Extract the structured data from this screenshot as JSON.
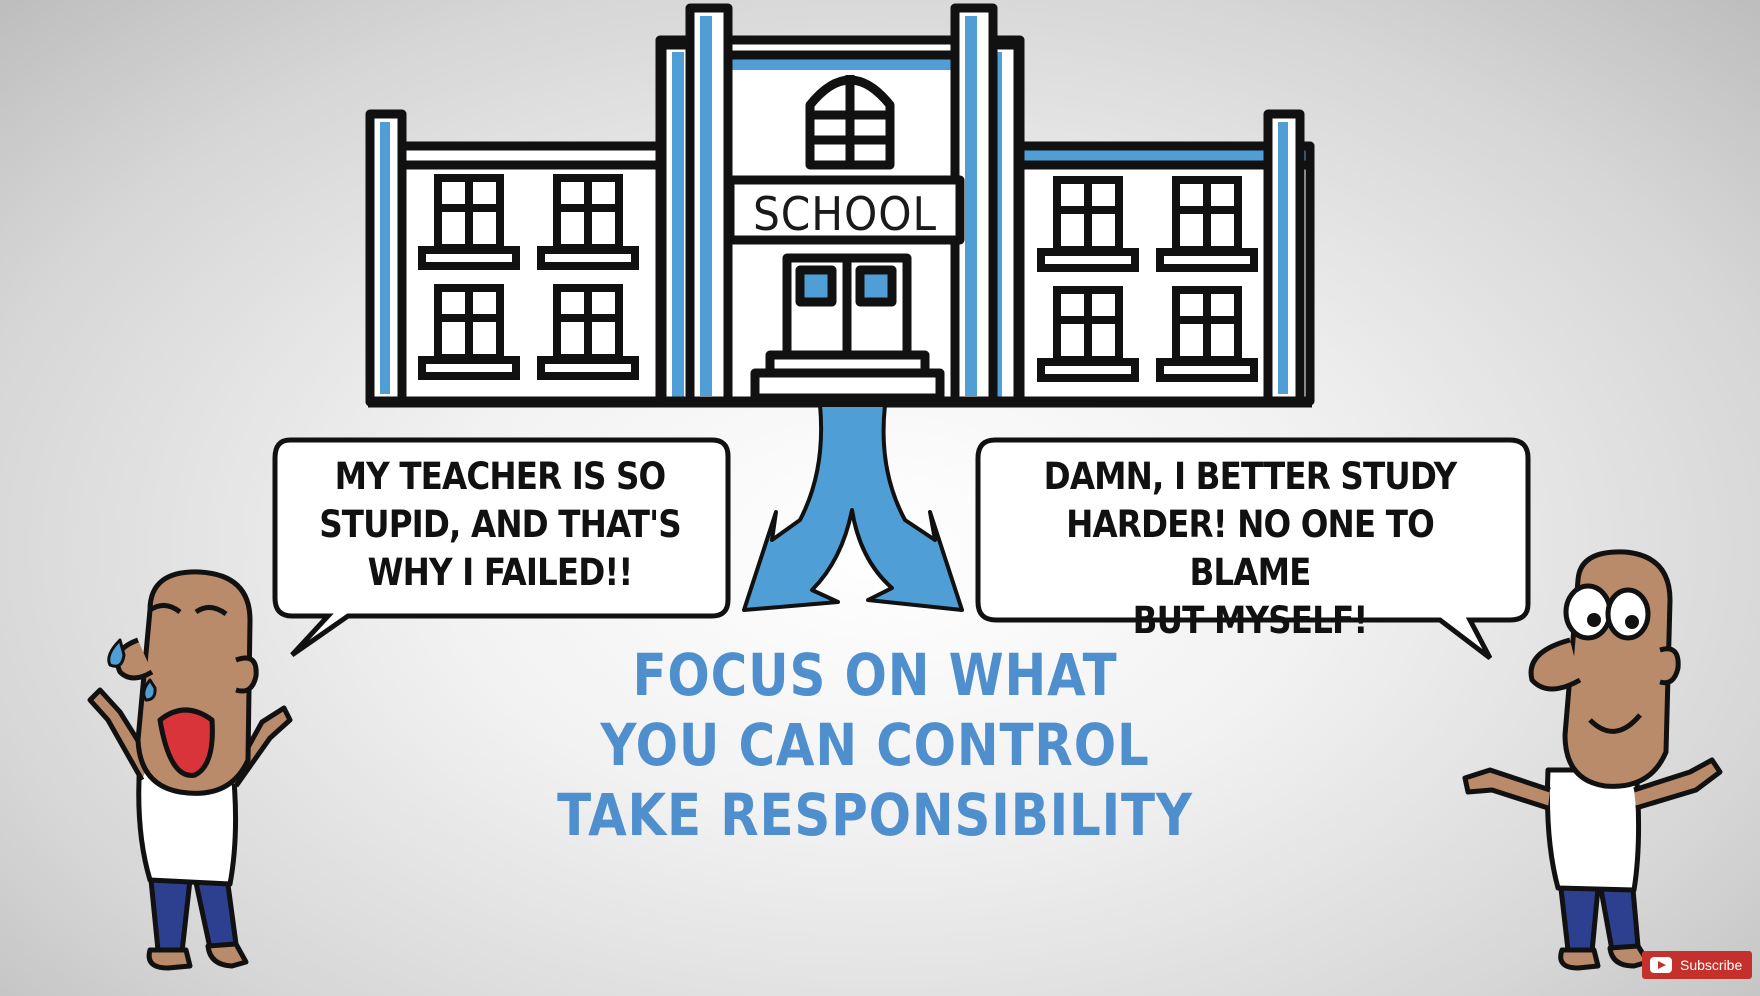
{
  "scene": {
    "school_sign": "SCHOOL",
    "left_bubble": [
      "MY TEACHER IS SO",
      "STUPID, AND THAT'S",
      "WHY I FAILED!!"
    ],
    "right_bubble": [
      "DAMN, I BETTER STUDY",
      "HARDER! NO ONE TO BLAME",
      "BUT MYSELF!"
    ],
    "message": [
      "FOCUS ON WHAT",
      "YOU CAN CONTROL",
      "TAKE RESPONSIBILITY"
    ]
  },
  "overlay": {
    "subscribe_label": "Subscribe",
    "icon": "youtube-play-icon"
  },
  "colors": {
    "accent_blue": "#4f9fd6",
    "message_blue": "#4f8fcd",
    "outline": "#111111",
    "subscribe_red": "#c4302b"
  }
}
